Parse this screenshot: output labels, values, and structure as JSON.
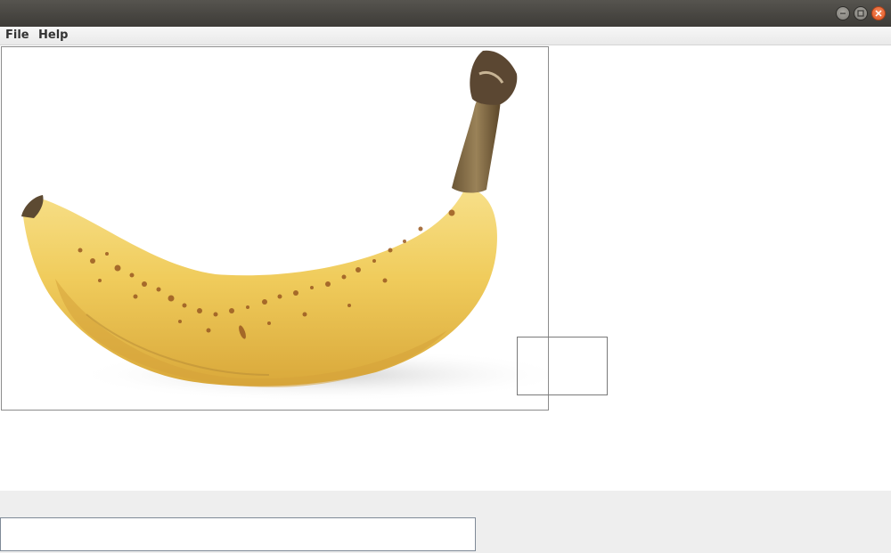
{
  "window": {
    "controls": [
      {
        "icon": "minimize-icon"
      },
      {
        "icon": "maximize-icon"
      },
      {
        "icon": "close-icon"
      }
    ]
  },
  "menu": {
    "file_label": "File",
    "help_label": "Help"
  },
  "canvas": {
    "image": "banana-photo"
  },
  "input": {
    "value": "",
    "placeholder": ""
  },
  "colors": {
    "titlebar": "#46443f",
    "close_button": "#e8582a",
    "banana": "#f2d264",
    "bottom_panel": "#eeeeee"
  }
}
